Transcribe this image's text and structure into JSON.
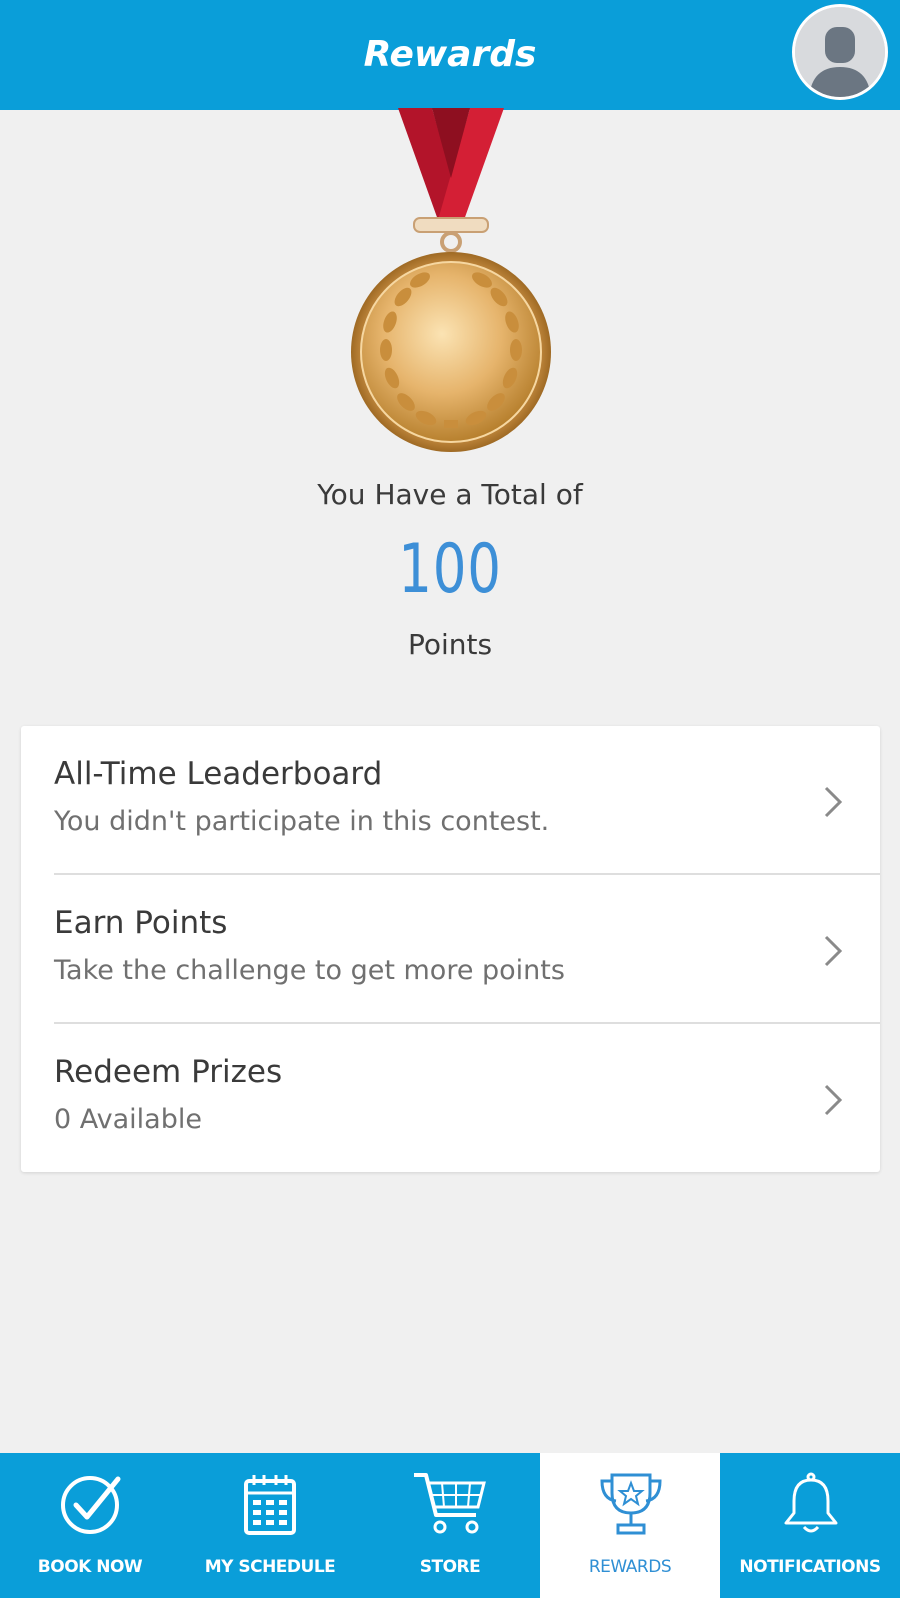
{
  "header": {
    "title": "Rewards",
    "avatar_icon": "user-avatar-icon"
  },
  "summary": {
    "total_label": "You Have a Total of",
    "points": "100",
    "points_label": "Points",
    "medal_icon": "gold-medal-icon"
  },
  "menu": {
    "items": [
      {
        "title": "All-Time Leaderboard",
        "subtitle": "You didn't participate in this contest.",
        "icon": "chevron-right-icon"
      },
      {
        "title": "Earn Points",
        "subtitle": "Take the challenge to get more points",
        "icon": "chevron-right-icon"
      },
      {
        "title": "Redeem Prizes",
        "subtitle": "0 Available",
        "icon": "chevron-right-icon"
      }
    ]
  },
  "tabs": [
    {
      "label": "BOOK NOW",
      "icon": "check-circle-icon",
      "active": false
    },
    {
      "label": "MY SCHEDULE",
      "icon": "calendar-icon",
      "active": false
    },
    {
      "label": "STORE",
      "icon": "cart-icon",
      "active": false
    },
    {
      "label": "REWARDS",
      "icon": "trophy-icon",
      "active": true
    },
    {
      "label": "NOTIFICATIONS",
      "icon": "bell-icon",
      "active": false
    }
  ],
  "colors": {
    "brand": "#0a9ed9",
    "points": "#3d8fd7",
    "ribbon": "#c0162b",
    "medal": "#d9a55a",
    "background": "#f0f0f0"
  }
}
